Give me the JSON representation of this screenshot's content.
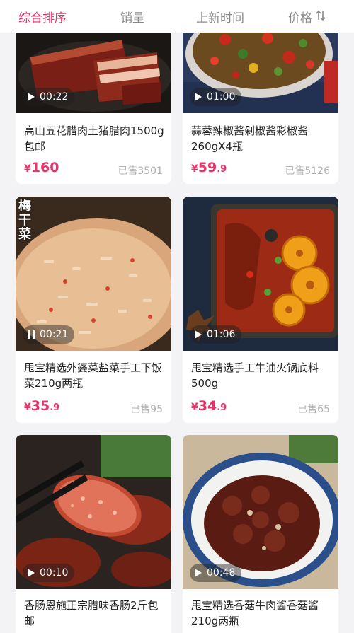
{
  "sort_tabs": [
    {
      "label": "综合排序",
      "active": true
    },
    {
      "label": "销量",
      "active": false
    },
    {
      "label": "上新时间",
      "active": false
    },
    {
      "label": "价格",
      "active": false
    }
  ],
  "colors": {
    "accent": "#e8336b",
    "muted": "#8a8a8a",
    "sold": "#b3b3b3"
  },
  "products": [
    {
      "title": "高山五花腊肉土猪腊肉1500g包邮",
      "currency": "¥",
      "price_int": "160",
      "price_dec": "",
      "sold": "已售3501",
      "duration": "00:22",
      "playing": false
    },
    {
      "title": "蒜蓉辣椒酱剁椒酱彩椒酱260gX4瓶",
      "currency": "¥",
      "price_int": "59",
      "price_dec": ".9",
      "sold": "已售5126",
      "duration": "01:00",
      "playing": false
    },
    {
      "title": "甩宝精选外婆菜盐菜手工下饭菜210g两瓶",
      "currency": "¥",
      "price_int": "35",
      "price_dec": ".9",
      "sold": "已售95",
      "duration": "00:21",
      "playing": true,
      "image_text": "梅干菜"
    },
    {
      "title": "甩宝精选手工牛油火锅底料500g",
      "currency": "¥",
      "price_int": "34",
      "price_dec": ".9",
      "sold": "已售65",
      "duration": "01:06",
      "playing": false
    },
    {
      "title": "香肠恩施正宗腊味香肠2斤包邮",
      "duration": "00:10",
      "playing": false
    },
    {
      "title": "甩宝精选香菇牛肉酱香菇酱210g两瓶",
      "duration": "00:48",
      "playing": false
    }
  ]
}
